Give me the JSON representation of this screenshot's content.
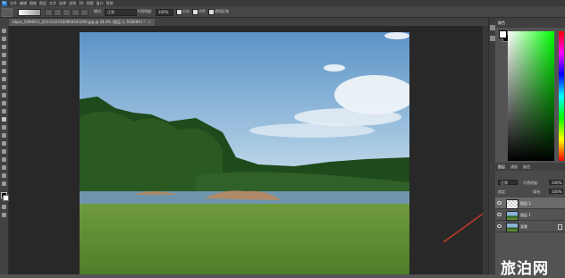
{
  "menubar": {
    "logo": "Ps",
    "items": [
      "文件",
      "编辑",
      "图像",
      "图层",
      "文字",
      "选择",
      "滤镜",
      "3D",
      "视图",
      "窗口",
      "帮助"
    ]
  },
  "options": {
    "opacity_label": "不透明度:",
    "opacity_value": "100%",
    "reverse_label": "反向",
    "dither_label": "仿色",
    "transparency_label": "透明区域",
    "mode_label": "模式:",
    "mode_value": "正常"
  },
  "document": {
    "tab_title": "hbpic_5094611_20131103160004543200.jpg @ 44.4% (图层 2, RGB/8#) *",
    "close_symbol": "×"
  },
  "panels": {
    "color_tab": "颜色",
    "layers_tabs": [
      "图层",
      "通道",
      "路径"
    ],
    "blend_mode": "正常",
    "opacity_label": "不透明度:",
    "opacity_value": "100%",
    "lock_label": "锁定:",
    "fill_label": "填充:",
    "fill_value": "100%",
    "layers": [
      {
        "name": "图层 2",
        "selected": true
      },
      {
        "name": "图层 1",
        "selected": false
      },
      {
        "name": "背景",
        "selected": false
      }
    ]
  },
  "watermark": "旅泊网",
  "colors": {
    "accent_blue": "#1c6fbf",
    "annotation_arrow": "#c0392b",
    "selected_layer": "#6a6a6a"
  }
}
